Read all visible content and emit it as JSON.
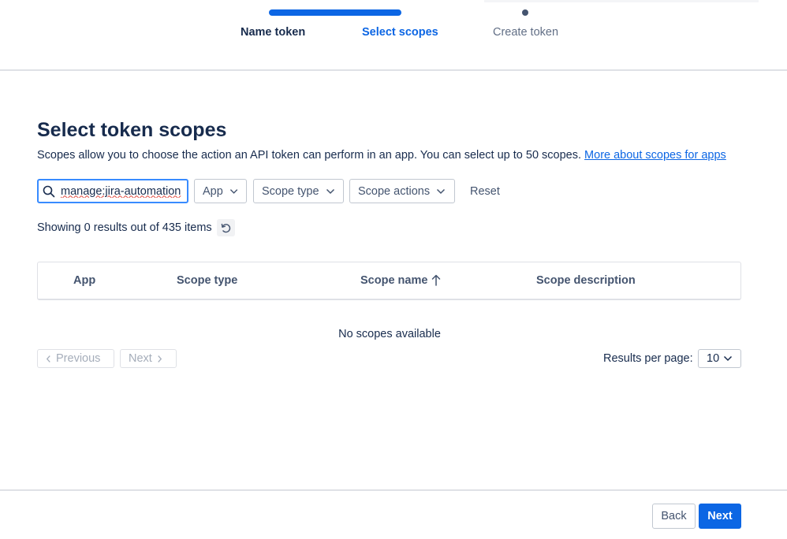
{
  "stepper": {
    "steps": [
      {
        "label": "Name token",
        "state": "complete"
      },
      {
        "label": "Select scopes",
        "state": "current"
      },
      {
        "label": "Create token",
        "state": "upcoming"
      }
    ]
  },
  "main": {
    "title": "Select token scopes",
    "description": "Scopes allow you to choose the action an API token can perform in an app. You can select up to 50 scopes.",
    "link_text": "More about scopes for apps"
  },
  "filters": {
    "search_value": "manage:jira-automation",
    "app_label": "App",
    "scope_type_label": "Scope type",
    "scope_actions_label": "Scope actions",
    "reset_label": "Reset"
  },
  "results": {
    "summary": "Showing 0 results out of 435 items"
  },
  "table": {
    "columns": [
      "App",
      "Scope type",
      "Scope name",
      "Scope description"
    ],
    "sorted_column": "Scope name",
    "sort_direction": "ascending",
    "empty_message": "No scopes available"
  },
  "pagination": {
    "previous_label": "Previous",
    "next_label": "Next",
    "results_per_page_label": "Results per page:",
    "results_per_page_value": "10"
  },
  "footer": {
    "back_label": "Back",
    "next_label": "Next"
  },
  "colors": {
    "accent": "#0c66e4",
    "text": "#172b4d",
    "subtle_text": "#44546f",
    "border": "#dfe1e6",
    "disabled_text": "#a5adba"
  }
}
